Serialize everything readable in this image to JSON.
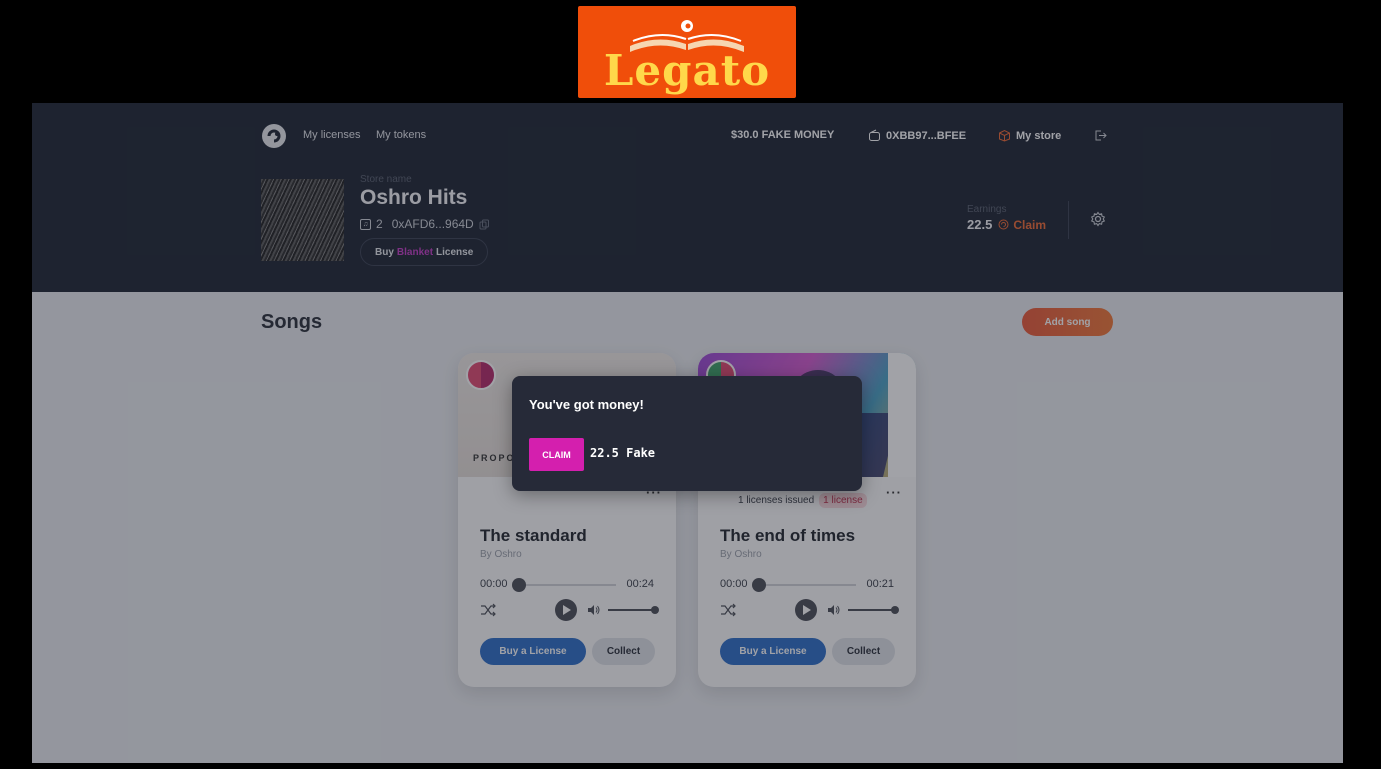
{
  "banner": {
    "text": "Legato"
  },
  "nav": {
    "links": [
      "My licenses",
      "My tokens"
    ],
    "money": "$30.0 FAKE MONEY",
    "wallet": "0XBB97...BFEE",
    "store": "My store"
  },
  "store": {
    "label": "Store name",
    "name": "Oshro Hits",
    "count": "2",
    "address": "0xAFD6...964D",
    "blanket_prefix": "Buy",
    "blanket_highlight": "Blanket",
    "blanket_suffix": "License"
  },
  "earnings": {
    "label": "Earnings",
    "value": "22.5",
    "claim": "Claim"
  },
  "songs": {
    "title": "Songs",
    "add_label": "Add song",
    "items": [
      {
        "art_text": "PROPO",
        "title": "The standard",
        "by": "By Oshro",
        "time_start": "00:00",
        "time_end": "00:24",
        "buy_label": "Buy a License",
        "collect_label": "Collect"
      },
      {
        "issued": "1 licenses issued",
        "badge": "1 license",
        "title": "The end of times",
        "by": "By Oshro",
        "time_start": "00:00",
        "time_end": "00:21",
        "buy_label": "Buy a License",
        "collect_label": "Collect"
      }
    ]
  },
  "dialog": {
    "title": "You've got money!",
    "claim_label": "CLAIM",
    "amount": "22.5 Fake"
  },
  "colors": {
    "header_bg": "#1e2533",
    "accent_orange": "#f06a35",
    "accent_pink": "#d41fae",
    "button_blue": "#2d6fc8"
  }
}
